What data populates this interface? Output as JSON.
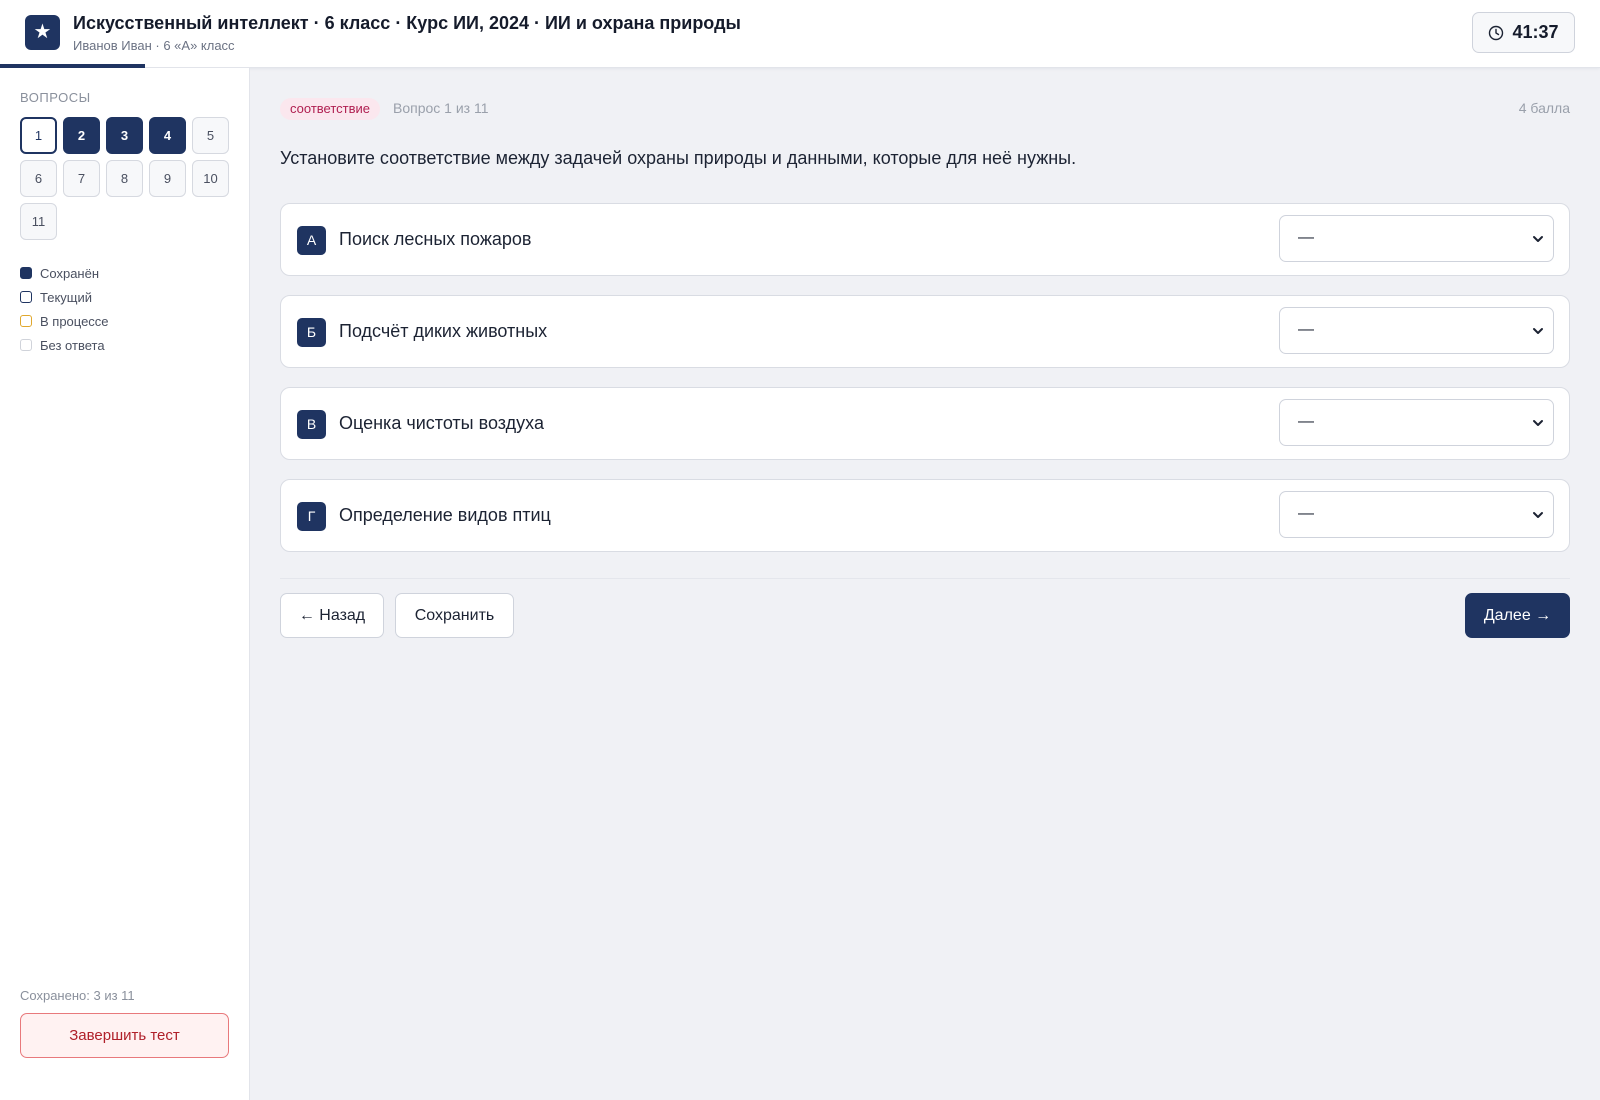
{
  "header": {
    "logo_glyph": "★",
    "title": "Искусственный интеллект · 6 класс · Курс ИИ, 2024 · ИИ и охрана природы",
    "subtitle": "Иванов Иван · 6 «А» класс",
    "progress_fraction": 0.0909,
    "timer": "41:37",
    "timer_icon": "clock-icon"
  },
  "sidebar": {
    "heading": "ВОПРОСЫ",
    "questions": [
      {
        "label": "1",
        "state": "current"
      },
      {
        "label": "2",
        "state": "saved"
      },
      {
        "label": "3",
        "state": "saved"
      },
      {
        "label": "4",
        "state": "saved"
      },
      {
        "label": "5",
        "state": "empty"
      },
      {
        "label": "6",
        "state": "empty"
      },
      {
        "label": "7",
        "state": "empty"
      },
      {
        "label": "8",
        "state": "empty"
      },
      {
        "label": "9",
        "state": "empty"
      },
      {
        "label": "10",
        "state": "empty"
      },
      {
        "label": "11",
        "state": "empty"
      }
    ],
    "legend": [
      {
        "label": "Сохранён",
        "state": "saved"
      },
      {
        "label": "Текущий",
        "state": "current"
      },
      {
        "label": "В процессе",
        "state": "progress"
      },
      {
        "label": "Без ответа",
        "state": "empty"
      }
    ],
    "saved_count": "Сохранено: 3 из 11",
    "finish_label": "Завершить тест"
  },
  "question": {
    "type_tag": "соответствие",
    "counter": "Вопрос 1 из 11",
    "points": "4 балла",
    "text": "Установите соответствие между задачей охраны природы и данными, которые для неё нужны.",
    "items": [
      {
        "letter": "А",
        "text": "Поиск лесных пожаров",
        "selected": "—"
      },
      {
        "letter": "Б",
        "text": "Подсчёт диких животных",
        "selected": "—"
      },
      {
        "letter": "В",
        "text": "Оценка чистоты воздуха",
        "selected": "—"
      },
      {
        "letter": "Г",
        "text": "Определение видов птиц",
        "selected": "—"
      }
    ]
  },
  "nav": {
    "back_label": "← Назад",
    "save_label": "Сохранить",
    "next_label": "Далее →"
  },
  "colors": {
    "accent": "#1f3461",
    "tag_bg": "#fbe7ee",
    "tag_text": "#b01e50",
    "finish_border": "#e8797c",
    "progress_legend": "#e0a82e"
  }
}
